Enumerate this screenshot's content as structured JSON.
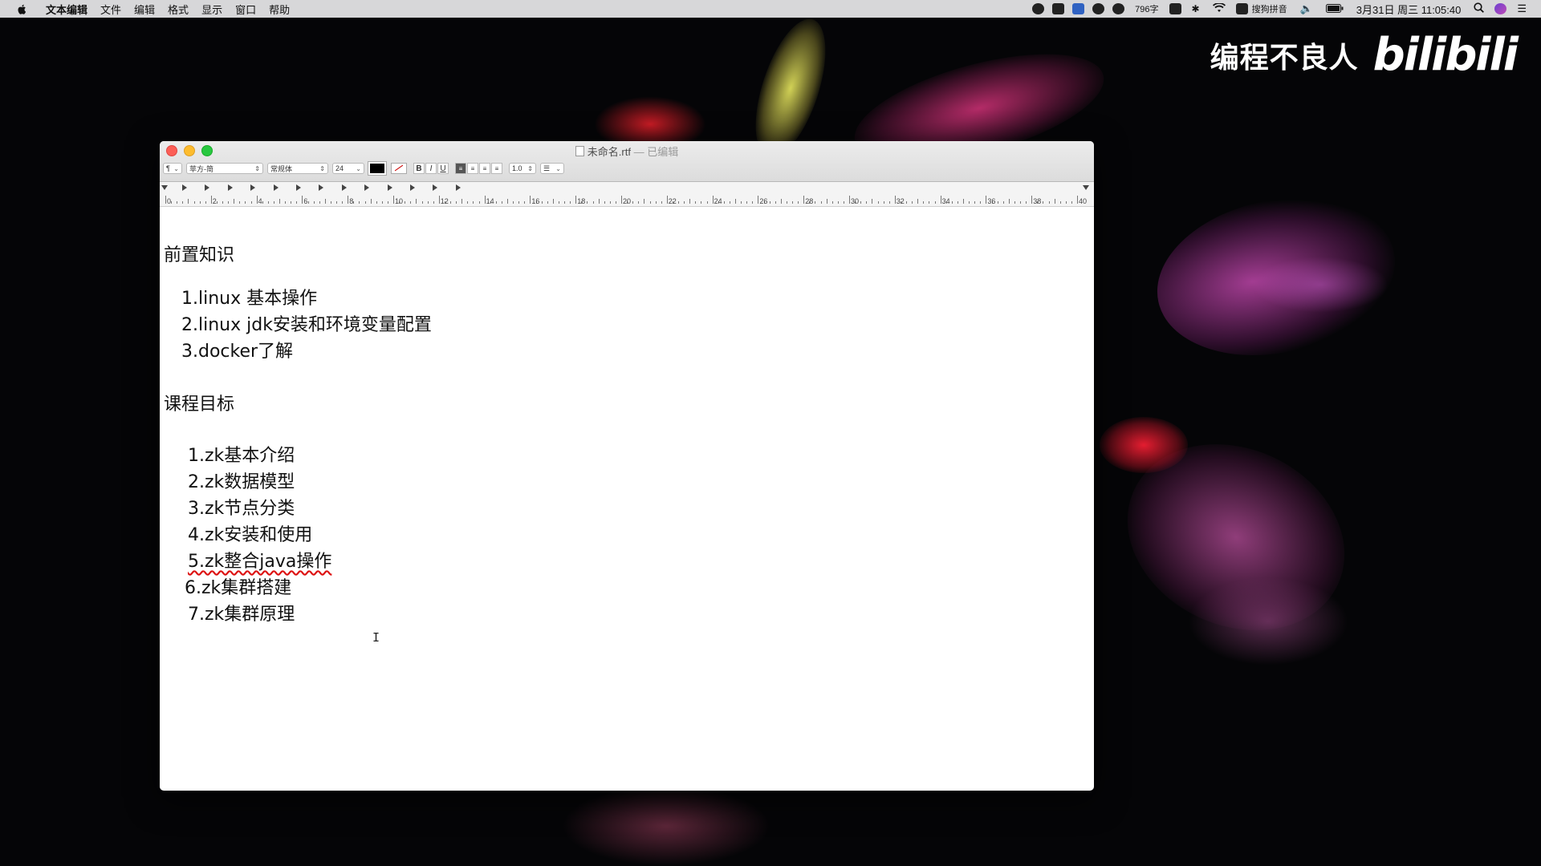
{
  "menubar": {
    "app_name": "文本编辑",
    "items": [
      "文件",
      "编辑",
      "格式",
      "显示",
      "窗口",
      "帮助"
    ],
    "status": {
      "word_count": "796字",
      "input_method": "搜狗拼音",
      "datetime": "3月31日 周三  11:05:40"
    }
  },
  "watermark": {
    "text": "编程不良人",
    "logo": "bilibili"
  },
  "window": {
    "title": "未命名.rtf",
    "edited": "— 已编辑",
    "toolbar": {
      "paragraph_style": "¶",
      "font_family": "苹方-简",
      "font_style": "常规体",
      "font_size": "24",
      "bold": "B",
      "italic": "I",
      "underline": "U",
      "line_spacing": "1.0",
      "list": "☰"
    },
    "ruler": {
      "labels": [
        "0",
        "2",
        "4",
        "6",
        "8",
        "10",
        "12",
        "14",
        "16",
        "18",
        "20",
        "22",
        "24",
        "26",
        "28",
        "30",
        "32",
        "34",
        "36",
        "38",
        "40"
      ]
    },
    "document": {
      "heading1": "前置知识",
      "section1": [
        "1.linux 基本操作",
        "2.linux jdk安装和环境变量配置",
        "3.docker了解"
      ],
      "heading2": "课程目标",
      "section2": [
        "1.zk基本介绍",
        "2.zk数据模型",
        "3.zk节点分类",
        "4.zk安装和使用",
        "5.zk整合java操作",
        "6.zk集群搭建",
        "7.zk集群原理"
      ]
    }
  }
}
